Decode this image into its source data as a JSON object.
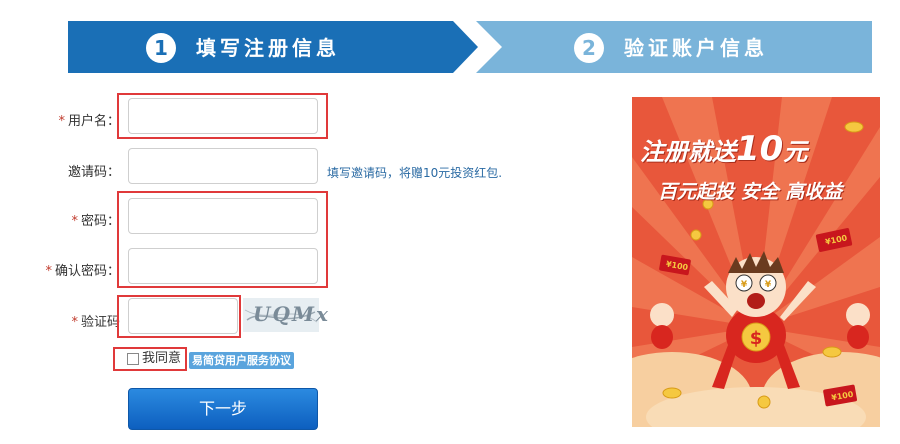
{
  "steps": [
    {
      "number": "1",
      "label": "填写注册信息"
    },
    {
      "number": "2",
      "label": "验证账户信息"
    }
  ],
  "form": {
    "required_mark": "*",
    "username_label": "用户名：",
    "invite_label": "邀请码：",
    "invite_hint": "填写邀请码，将赠10元投资红包.",
    "password_label": "密码：",
    "confirm_label": "确认密码：",
    "captcha_label": "验证码",
    "captcha_text": "UQMx",
    "agree_label": "我同意",
    "terms_label": "易简贷用户服务协议",
    "next_label": "下一步"
  },
  "promo": {
    "title": "注册就送",
    "amount": "10",
    "unit": "元",
    "subtitle": "百元起投 安全 高收益",
    "envelope_text": "¥100",
    "coin_symbol": "$",
    "colors": {
      "background": "#e8573b",
      "accent": "#f5c840",
      "cloud": "#f7cfa0"
    }
  },
  "colors": {
    "step_active": "#1a6fb6",
    "step_inactive": "#7ab4da",
    "highlight": "#e0393a",
    "required": "#c0392b"
  }
}
